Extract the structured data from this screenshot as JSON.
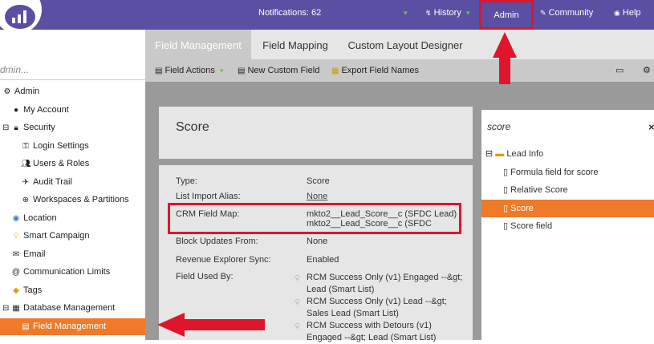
{
  "topbar": {
    "notifications_label": "Notifications: 62",
    "history_label": "History",
    "admin_label": "Admin",
    "community_label": "Community",
    "help_label": "Help"
  },
  "sidebar": {
    "search_value": "dmin...",
    "items": [
      {
        "label": "Admin",
        "icon": "gear-icon"
      },
      {
        "label": "My Account",
        "icon": "person-icon"
      },
      {
        "label": "Security",
        "icon": "lock-icon"
      },
      {
        "label": "Login Settings",
        "icon": "key-icon"
      },
      {
        "label": "Users & Roles",
        "icon": "users-icon"
      },
      {
        "label": "Audit Trail",
        "icon": "audit-icon"
      },
      {
        "label": "Workspaces & Partitions",
        "icon": "globe-icon"
      },
      {
        "label": "Location",
        "icon": "location-icon"
      },
      {
        "label": "Smart Campaign",
        "icon": "bulb-icon"
      },
      {
        "label": "Email",
        "icon": "email-icon"
      },
      {
        "label": "Communication Limits",
        "icon": "at-icon"
      },
      {
        "label": "Tags",
        "icon": "tag-icon"
      },
      {
        "label": "Database Management",
        "icon": "database-icon"
      },
      {
        "label": "Field Management",
        "icon": "field-icon"
      }
    ]
  },
  "tabs": [
    {
      "label": "Field Management"
    },
    {
      "label": "Field Mapping"
    },
    {
      "label": "Custom Layout Designer"
    }
  ],
  "toolbar": {
    "field_actions": "Field Actions",
    "new_custom_field": "New Custom Field",
    "export_field_names": "Export Field Names"
  },
  "detail": {
    "title": "Score",
    "rows": {
      "type_label": "Type:",
      "type_value": "Score",
      "alias_label": "List Import Alias:",
      "alias_value": "None",
      "crm_label": "CRM Field Map:",
      "crm_value_1": "mkto2__Lead_Score__c (SFDC Lead)",
      "crm_value_2": "mkto2__Lead_Score__c (SFDC",
      "block_label": "Block Updates From:",
      "block_value": "None",
      "rev_label": "Revenue Explorer Sync:",
      "rev_value": "Enabled",
      "used_label": "Field Used By:",
      "used_1": "RCM Success Only (v1) Engaged --&gt; Lead (Smart List)",
      "used_2": "RCM Success Only (v1) Lead --&gt; Sales Lead (Smart List)",
      "used_3": "RCM Success with Detours (v1) Engaged --&gt; Lead (Smart List)"
    }
  },
  "right_panel": {
    "search_value": "score",
    "close_label": "×",
    "group_label": "Lead Info",
    "items": [
      {
        "label": "Formula field for score"
      },
      {
        "label": "Relative Score"
      },
      {
        "label": "Score"
      },
      {
        "label": "Score field"
      }
    ]
  },
  "colors": {
    "brand_purple": "#5a4fa3",
    "selection_orange": "#ee7a2a",
    "annotation_red": "#e0142a"
  }
}
